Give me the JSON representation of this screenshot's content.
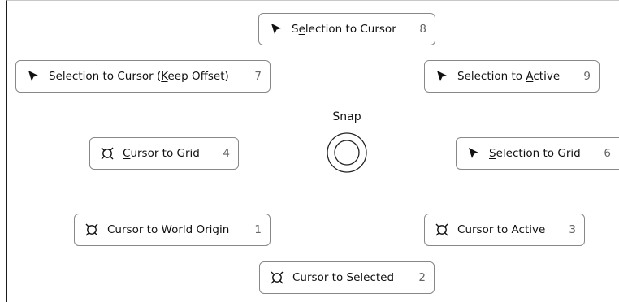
{
  "pie_menu": {
    "title": "Snap",
    "items": [
      {
        "id": "sel-to-cursor",
        "icon": "cursor-arrow-icon",
        "pre": "S",
        "ul": "e",
        "post": "lection to Cursor",
        "key": "8"
      },
      {
        "id": "sel-to-cursor-keep-offset",
        "icon": "cursor-arrow-icon",
        "pre": "Selection to Cursor (",
        "ul": "K",
        "post": "eep Offset)",
        "key": "7"
      },
      {
        "id": "sel-to-active",
        "icon": "cursor-arrow-icon",
        "pre": "Selection to ",
        "ul": "A",
        "post": "ctive",
        "key": "9"
      },
      {
        "id": "cursor-to-grid",
        "icon": "3d-cursor-icon",
        "pre": "",
        "ul": "C",
        "post": "ursor to Grid",
        "key": "4"
      },
      {
        "id": "sel-to-grid",
        "icon": "cursor-arrow-icon",
        "pre": "",
        "ul": "S",
        "post": "election to Grid",
        "key": "6"
      },
      {
        "id": "cursor-to-world-origin",
        "icon": "3d-cursor-icon",
        "pre": "Cursor to ",
        "ul": "W",
        "post": "orld Origin",
        "key": "1"
      },
      {
        "id": "cursor-to-active",
        "icon": "3d-cursor-icon",
        "pre": "C",
        "ul": "u",
        "post": "rsor to Active",
        "key": "3"
      },
      {
        "id": "cursor-to-selected",
        "icon": "3d-cursor-icon",
        "pre": "Cursor ",
        "ul": "t",
        "post": "o Selected",
        "key": "2"
      }
    ]
  }
}
